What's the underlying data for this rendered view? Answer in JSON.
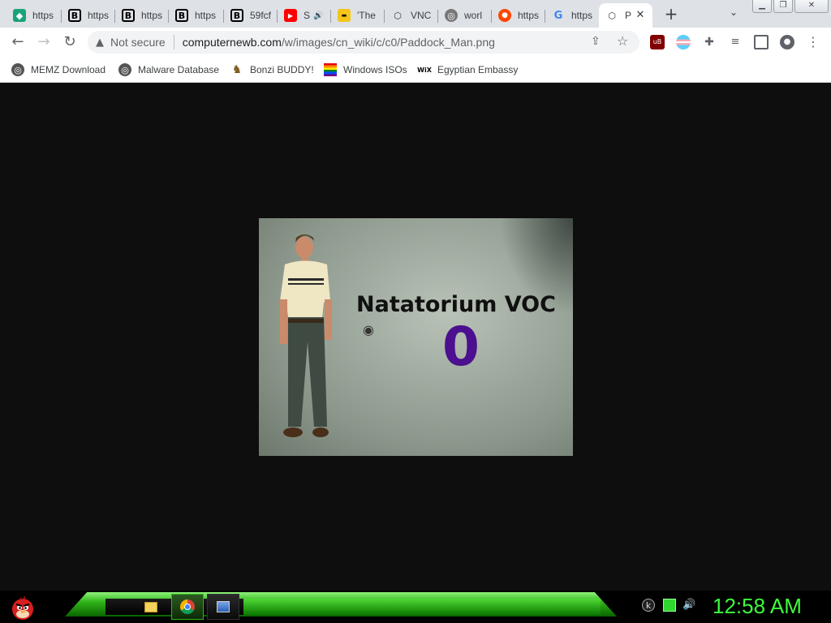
{
  "tabs": [
    {
      "title": "https",
      "icon": "green-cube-icon"
    },
    {
      "title": "https",
      "icon": "b-icon"
    },
    {
      "title": "https",
      "icon": "b-icon"
    },
    {
      "title": "https",
      "icon": "b-icon"
    },
    {
      "title": "59fcf",
      "icon": "b-icon"
    },
    {
      "title": "S",
      "icon": "youtube-icon"
    },
    {
      "title": "'The",
      "icon": "imdb-icon"
    },
    {
      "title": "VNC",
      "icon": "vnc-icon"
    },
    {
      "title": "worl",
      "icon": "globe-icon"
    },
    {
      "title": "https",
      "icon": "reddit-icon"
    },
    {
      "title": "https",
      "icon": "google-icon"
    },
    {
      "title": "P",
      "icon": "vnc-icon"
    }
  ],
  "toolbar": {
    "security_label": "Not secure",
    "url_host": "computernewb.com",
    "url_path": "/w/images/cn_wiki/c/c0/Paddock_Man.png"
  },
  "bookmarks": [
    {
      "label": "MEMZ Download",
      "icon": "globe-icon"
    },
    {
      "label": "Malware Database",
      "icon": "globe-icon"
    },
    {
      "label": "Bonzi BUDDY!",
      "icon": "bonzi-icon"
    },
    {
      "label": "Windows ISOs",
      "icon": "rainbow-flag-icon"
    },
    {
      "label": "Egyptian Embassy",
      "icon": "wix-icon"
    }
  ],
  "image": {
    "caption": "Natatorium VOC",
    "value": "0"
  },
  "taskbar": {
    "clock": "12:58 AM"
  },
  "colors": {
    "clock": "#3dfc3d",
    "value": "#4b0f8f",
    "taskbar_green": "#2fb51a"
  }
}
